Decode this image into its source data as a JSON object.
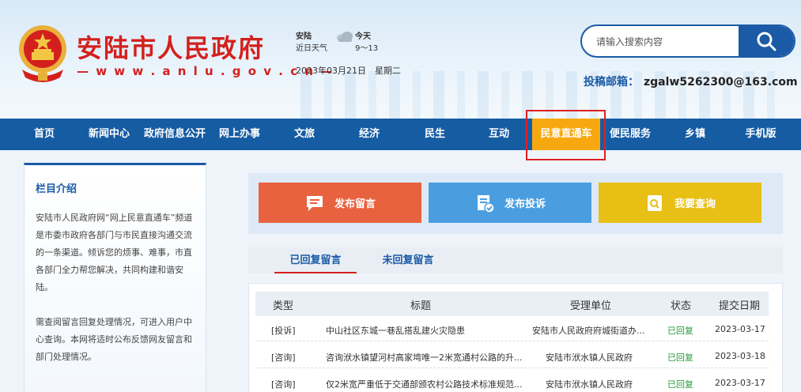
{
  "header": {
    "title": "安陆市人民政府",
    "url": "— w w w . a n l u . g o v . c n —",
    "weather": {
      "city": "安陆",
      "label": "近日天气",
      "day": "今天",
      "temp": "9～13",
      "date": "2023年03月21日",
      "weekday": "星期二"
    },
    "search": {
      "placeholder": "请输入搜索内容"
    },
    "mail_label": "投稿邮箱：",
    "mail_address": "zgalw5262300@163.com"
  },
  "nav": {
    "items": [
      "首页",
      "新闻中心",
      "政府信息公开",
      "网上办事",
      "文旅",
      "经济",
      "民生",
      "互动",
      "民意直通车",
      "便民服务",
      "乡镇",
      "手机版"
    ],
    "active": "民意直通车"
  },
  "intro": {
    "title": "栏目介绍",
    "p1": "安陆市人民政府网“网上民意直通车”频道是市委市政府各部门与市民直接沟通交流的一条渠道。倾诉您的烦事、难事，市直各部门全力帮您解决，共同构建和谐安陆。",
    "p2": "需查阅留言回复处理情况，可进入用户中心查询。本网将适时公布反馈网友留言和部门处理情况。"
  },
  "actions": [
    {
      "label": "发布留言",
      "color": "#e8623f",
      "icon": "message-icon"
    },
    {
      "label": "发布投诉",
      "color": "#4a9ee0",
      "icon": "complaint-icon"
    },
    {
      "label": "我要查询",
      "color": "#e8bf14",
      "icon": "search-doc-icon"
    }
  ],
  "tabs": [
    "已回复留言",
    "未回复留言"
  ],
  "table": {
    "headers": [
      "类型",
      "标题",
      "受理单位",
      "状态",
      "提交日期"
    ],
    "rows": [
      {
        "type": "[投诉]",
        "title": "中山社区东城一巷乱搭乱建火灾隐患",
        "unit": "安陆市人民政府府城街道办...",
        "status": "已回复",
        "date": "2023-03-17"
      },
      {
        "type": "[咨询]",
        "title": "咨询洑水镇望河村高家塆唯一2米宽通村公路的升...",
        "unit": "安陆市洑水镇人民政府",
        "status": "已回复",
        "date": "2023-03-18"
      },
      {
        "type": "[咨询]",
        "title": "仅2米宽严重低于交通部颁农村公路技术标准规范...",
        "unit": "安陆市洑水镇人民政府",
        "status": "已回复",
        "date": "2023-03-17"
      }
    ]
  },
  "colors": {
    "brand_red": "#d3201d",
    "nav_blue": "#155ca3",
    "active_orange": "#f7a811",
    "status_green": "#2a9d3a"
  }
}
